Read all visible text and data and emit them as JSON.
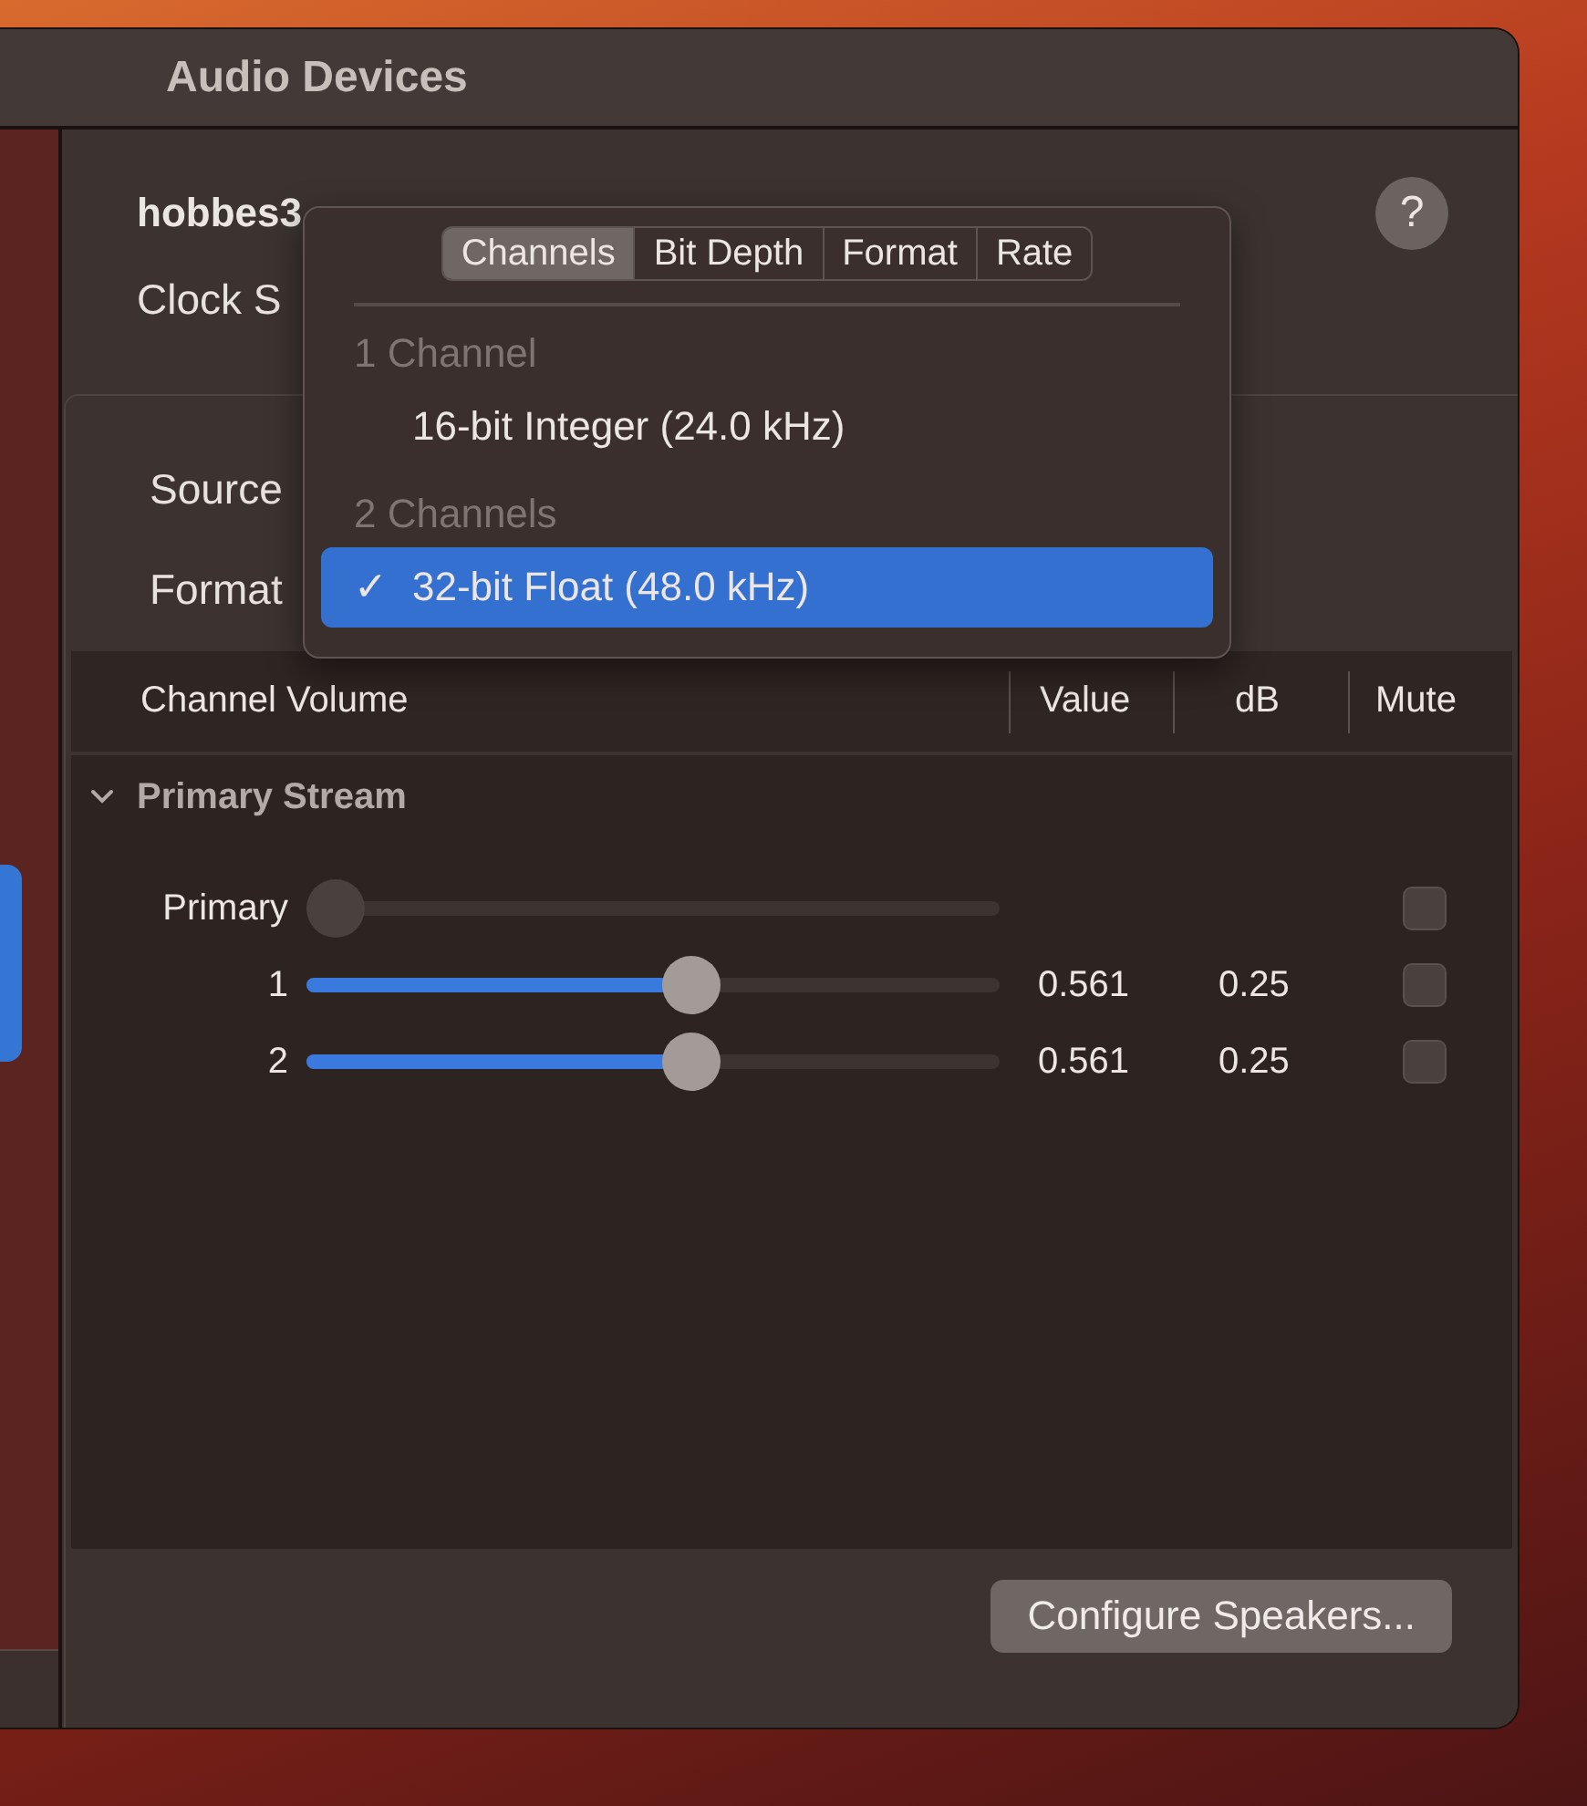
{
  "window": {
    "title": "Audio Devices"
  },
  "device": {
    "name": "hobbes3",
    "help": "?"
  },
  "labels": [
    "Clock S",
    "Source",
    "Format"
  ],
  "popover": {
    "check_mark": "✓",
    "tabs": [
      {
        "label": "Channels",
        "selected": true
      },
      {
        "label": "Bit Depth",
        "selected": false
      },
      {
        "label": "Format",
        "selected": false
      },
      {
        "label": "Rate",
        "selected": false
      }
    ],
    "groups": [
      {
        "heading": "1 Channel",
        "items": [
          {
            "label": "16-bit Integer (24.0 kHz)",
            "selected": false
          }
        ]
      },
      {
        "heading": "2 Channels",
        "items": [
          {
            "label": "32-bit Float (48.0 kHz)",
            "selected": true
          }
        ]
      }
    ]
  },
  "table": {
    "columns": [
      "Channel Volume",
      "Value",
      "dB",
      "Mute"
    ],
    "group": {
      "title": "Primary Stream",
      "expanded": true
    },
    "rows": [
      {
        "label": "Primary",
        "level": 0,
        "disabled": true,
        "checked": false
      },
      {
        "label": "1",
        "level": 0.555,
        "disabled": false,
        "value": "0.561",
        "db": "0.25",
        "checked": false
      },
      {
        "label": "2",
        "level": 0.555,
        "disabled": false,
        "value": "0.561",
        "db": "0.25",
        "checked": false
      }
    ]
  },
  "buttons": [
    "Configure Speakers..."
  ]
}
